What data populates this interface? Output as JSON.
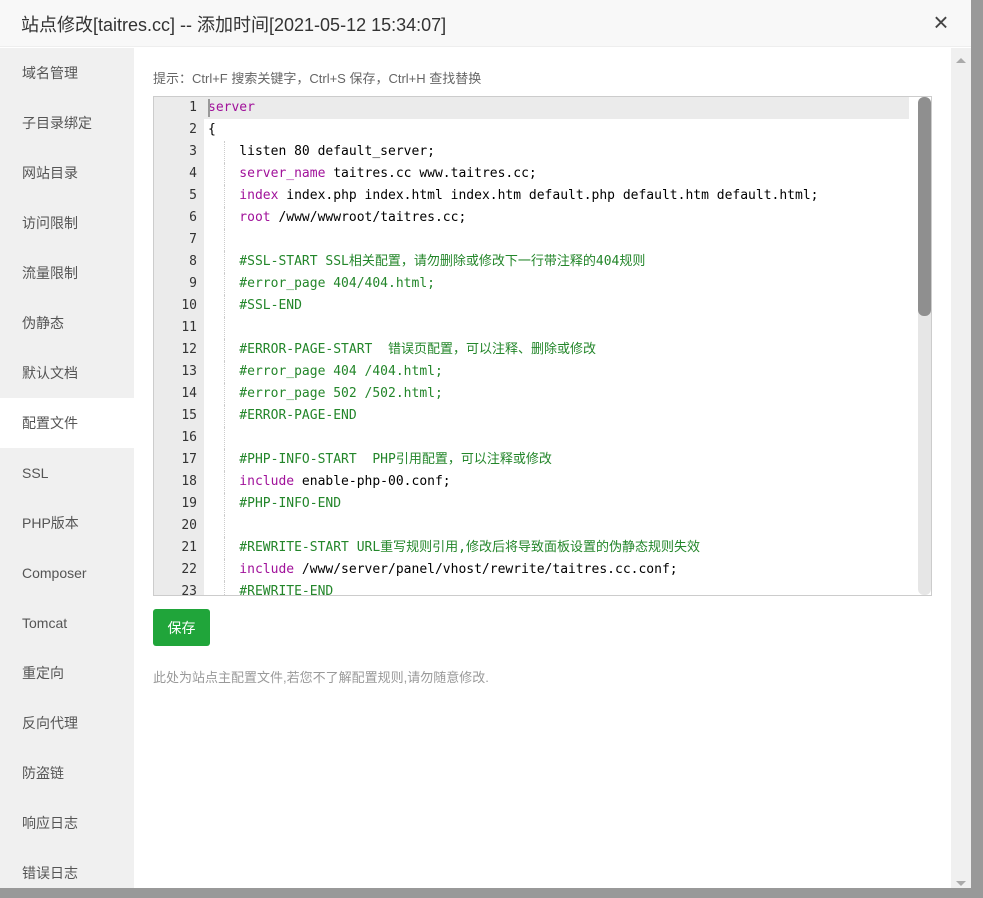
{
  "dialog": {
    "title": "站点修改[taitres.cc] -- 添加时间[2021-05-12 15:34:07]",
    "close_icon": "×"
  },
  "sidebar": {
    "items": [
      {
        "label": "域名管理"
      },
      {
        "label": "子目录绑定"
      },
      {
        "label": "网站目录"
      },
      {
        "label": "访问限制"
      },
      {
        "label": "流量限制"
      },
      {
        "label": "伪静态"
      },
      {
        "label": "默认文档"
      },
      {
        "label": "配置文件",
        "active": true
      },
      {
        "label": "SSL"
      },
      {
        "label": "PHP版本"
      },
      {
        "label": "Composer"
      },
      {
        "label": "Tomcat"
      },
      {
        "label": "重定向"
      },
      {
        "label": "反向代理"
      },
      {
        "label": "防盗链"
      },
      {
        "label": "响应日志"
      },
      {
        "label": "错误日志"
      }
    ]
  },
  "main": {
    "tip": "提示：Ctrl+F 搜索关键字，Ctrl+S 保存，Ctrl+H 查找替换",
    "save_label": "保存",
    "note": "此处为站点主配置文件,若您不了解配置规则,请勿随意修改.",
    "colors": {
      "keyword": "#a0119a",
      "comment": "#23862a",
      "save_button": "#20a53a"
    },
    "editor_scroll_fraction": 0.44,
    "code_lines": [
      [
        [
          "kw",
          "server"
        ]
      ],
      [
        [
          "",
          "{"
        ]
      ],
      [
        [
          "",
          "    listen 80 default_server;"
        ]
      ],
      [
        [
          "kw",
          "    server_name"
        ],
        [
          "",
          " taitres.cc www.taitres.cc;"
        ]
      ],
      [
        [
          "kw",
          "    index"
        ],
        [
          "",
          " index.php index.html index.htm default.php default.htm default.html;"
        ]
      ],
      [
        [
          "kw",
          "    root"
        ],
        [
          "",
          " /www/wwwroot/taitres.cc;"
        ]
      ],
      [
        [
          "",
          "    "
        ]
      ],
      [
        [
          "cm",
          "    #SSL-START SSL相关配置，请勿删除或修改下一行带注释的404规则"
        ]
      ],
      [
        [
          "cm",
          "    #error_page 404/404.html;"
        ]
      ],
      [
        [
          "cm",
          "    #SSL-END"
        ]
      ],
      [
        [
          "",
          "    "
        ]
      ],
      [
        [
          "cm",
          "    #ERROR-PAGE-START  错误页配置，可以注释、删除或修改"
        ]
      ],
      [
        [
          "cm",
          "    #error_page 404 /404.html;"
        ]
      ],
      [
        [
          "cm",
          "    #error_page 502 /502.html;"
        ]
      ],
      [
        [
          "cm",
          "    #ERROR-PAGE-END"
        ]
      ],
      [
        [
          "",
          "    "
        ]
      ],
      [
        [
          "cm",
          "    #PHP-INFO-START  PHP引用配置，可以注释或修改"
        ]
      ],
      [
        [
          "kw",
          "    include"
        ],
        [
          "",
          " enable-php-00.conf;"
        ]
      ],
      [
        [
          "cm",
          "    #PHP-INFO-END"
        ]
      ],
      [
        [
          "",
          "    "
        ]
      ],
      [
        [
          "cm",
          "    #REWRITE-START URL重写规则引用,修改后将导致面板设置的伪静态规则失效"
        ]
      ],
      [
        [
          "kw",
          "    include"
        ],
        [
          "",
          " /www/server/panel/vhost/rewrite/taitres.cc.conf;"
        ]
      ],
      [
        [
          "cm",
          "    #REWRITE-END"
        ]
      ]
    ]
  }
}
